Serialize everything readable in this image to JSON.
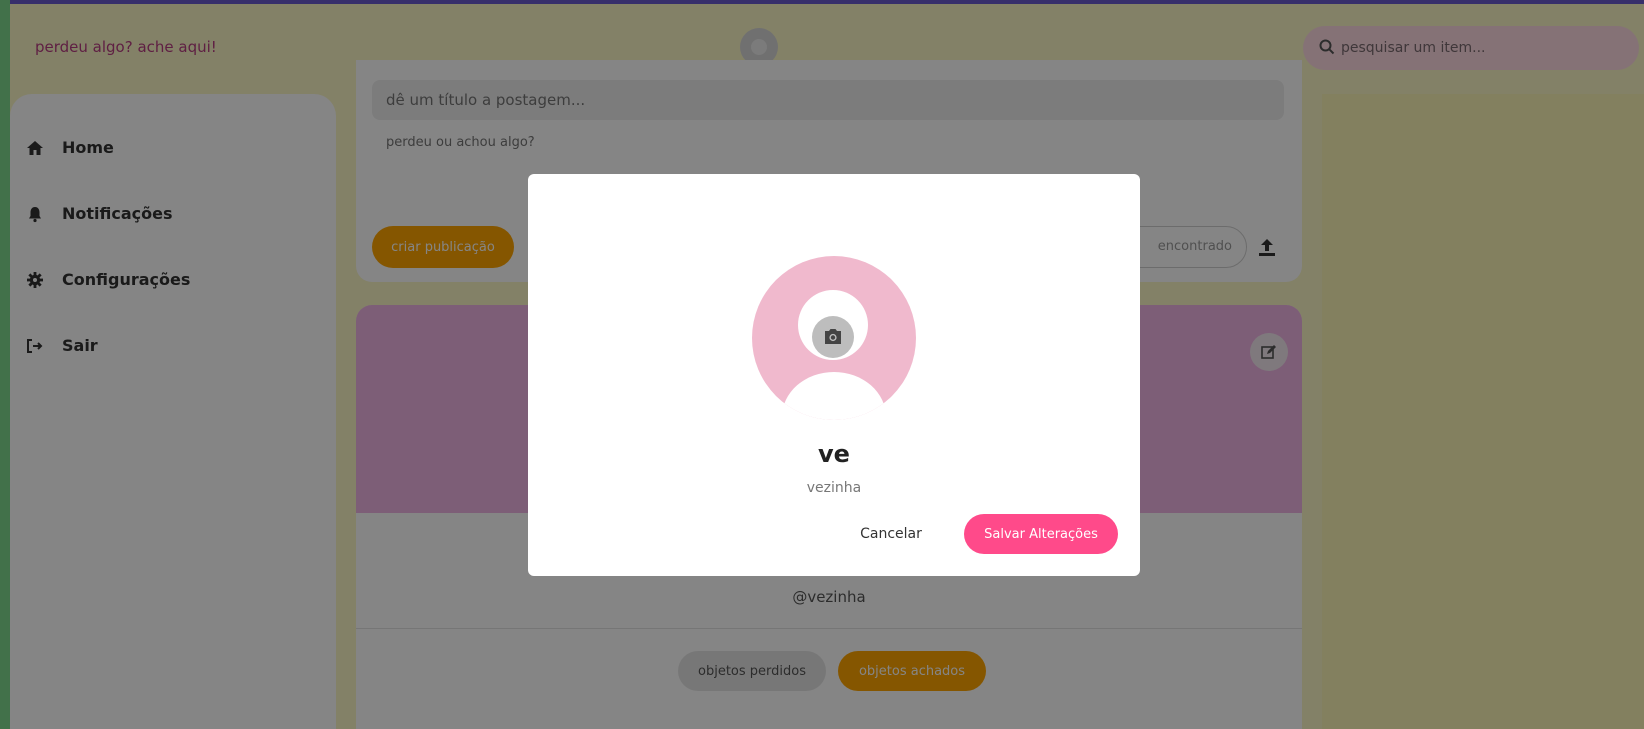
{
  "header": {
    "brand": "perdeu algo? ache aqui!",
    "search_placeholder": "pesquisar um item..."
  },
  "sidebar": {
    "items": [
      {
        "label": "Home",
        "icon": "home-icon"
      },
      {
        "label": "Notificações",
        "icon": "bell-icon"
      },
      {
        "label": "Configurações",
        "icon": "gear-icon"
      },
      {
        "label": "Sair",
        "icon": "logout-icon"
      }
    ]
  },
  "composer": {
    "title_placeholder": "dê um título a postagem...",
    "body_placeholder": "perdeu ou achou algo?",
    "create_label": "criar publicação",
    "found_chip_label": "encontrado"
  },
  "profile": {
    "handle": "@vezinha",
    "tab_lost": "objetos perdidos",
    "tab_found": "objetos achados"
  },
  "modal": {
    "name": "ve",
    "username": "vezinha",
    "cancel_label": "Cancelar",
    "save_label": "Salvar Alterações"
  },
  "colors": {
    "brand_text": "#b63d80",
    "accent_orange": "#ffa500",
    "accent_pink": "#ff4a8a",
    "cover_pink": "#f0b5e4",
    "page_bg": "#fbf7c6"
  }
}
